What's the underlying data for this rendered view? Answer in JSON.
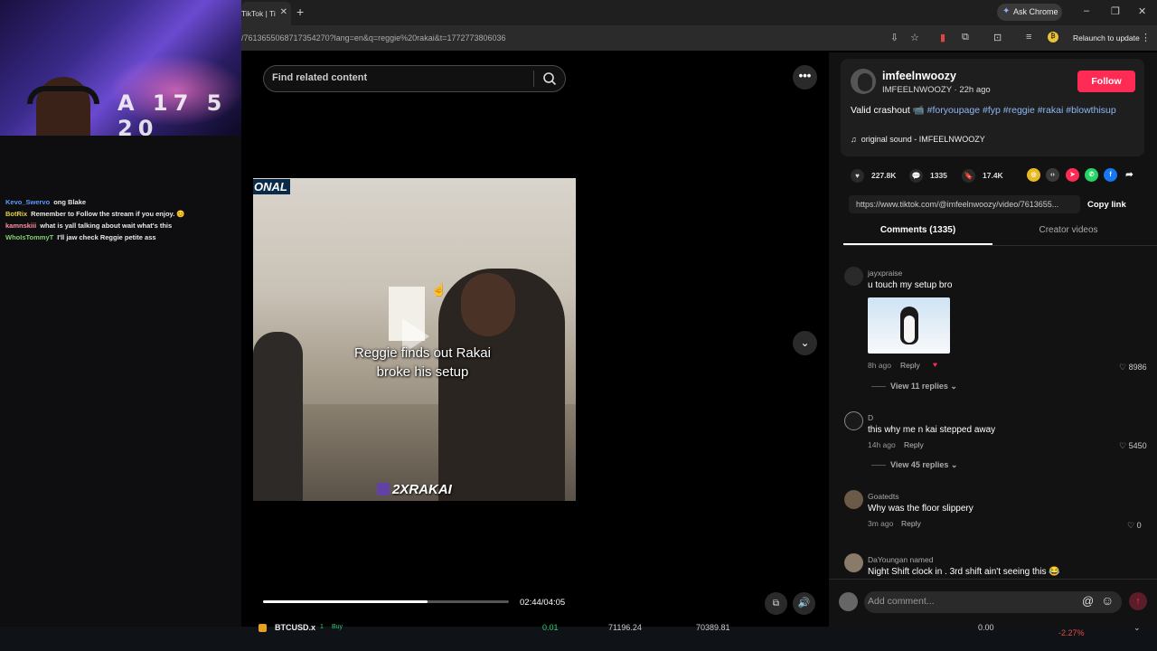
{
  "stream": {
    "jersey_text": "A 17 5 20",
    "chat": [
      {
        "user": "Kevo_Swervo",
        "color": "#5b9bff",
        "message": "ong Blake"
      },
      {
        "user": "BotRix",
        "color": "#e6d23a",
        "message": "Remember to Follow the stream if you enjoy. 😊"
      },
      {
        "user": "kamnskiii",
        "color": "#ff8fa3",
        "message": "what is yall talking about wait what's this"
      },
      {
        "user": "WhoIsTommyT",
        "color": "#7fd16b",
        "message": "I'll jaw check Reggie petite ass"
      }
    ]
  },
  "browser": {
    "tab_title": "TikTok | Ti",
    "url": "/7613655068717354270?lang=en&q=reggie%20rakai&t=1772773806036",
    "ask_chrome": "Ask Chrome",
    "relaunch": "Relaunch to update"
  },
  "video": {
    "search_placeholder": "Find related content",
    "banner_tag": "ONAL",
    "caption_line1": "Reggie finds out Rakai",
    "caption_line2": "broke his setup",
    "watermark": "2XRAKAI",
    "progress": 0.67,
    "time": "02:44/04:05"
  },
  "creator": {
    "username": "imfeelnwoozy",
    "handle_line": "IMFEELNWOOZY · 22h ago",
    "follow_label": "Follow",
    "desc_text": "Valid crashout 📹 ",
    "hashtags": [
      "#foryoupage",
      "#fyp",
      "#reggie",
      "#rakai",
      "#blowthisup"
    ],
    "sound": "original sound - IMFEELNWOOZY",
    "likes": "227.8K",
    "comments": "1335",
    "saves": "17.4K",
    "link": "https://www.tiktok.com/@imfeelnwoozy/video/7613655...",
    "copy_link_label": "Copy link"
  },
  "tabs": {
    "comments_label": "Comments (1335)",
    "creator_videos_label": "Creator videos"
  },
  "comments": [
    {
      "user": "jayxpraise",
      "text": "u touch my setup bro",
      "time": "8h ago",
      "reply": "Reply",
      "likes": "8986",
      "replies": "View 11 replies"
    },
    {
      "user": "D",
      "text": "this why me n kai stepped away",
      "time": "14h ago",
      "reply": "Reply",
      "likes": "5450",
      "replies": "View 45 replies"
    },
    {
      "user": "Goatedts",
      "text": "Why was the floor slippery",
      "time": "3m ago",
      "reply": "Reply",
      "likes": "0"
    },
    {
      "user": "DaYoungan named",
      "text": "Night Shift clock in . 3rd shift ain't seeing this 😂"
    }
  ],
  "add_comment": {
    "placeholder": "Add comment..."
  },
  "ticker": {
    "symbol": "BTCUSD.x",
    "tag1": "1",
    "tag2": "Buy",
    "v1": "0.01",
    "v2": "71196.24",
    "v3": "70389.81",
    "v4": "0.00",
    "change": "-2.27%"
  },
  "colors": {
    "accent": "#fe2c55",
    "hashtag": "#8fb7f5"
  }
}
